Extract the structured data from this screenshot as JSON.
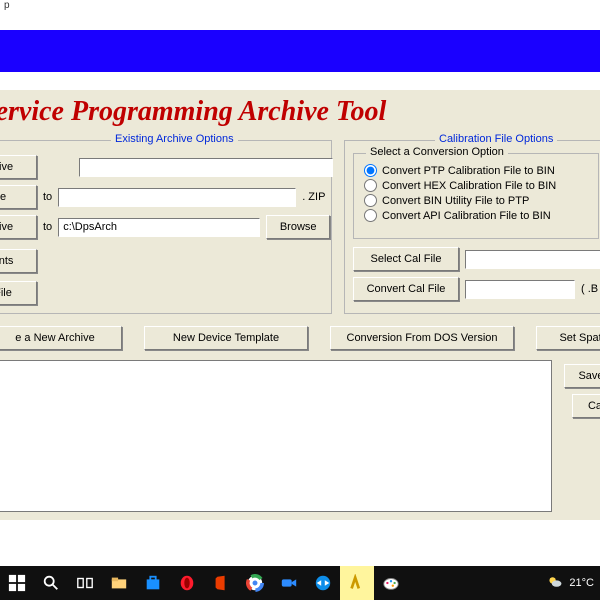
{
  "menu_hint": "p",
  "app_title": "Service Programming Archive Tool",
  "existing": {
    "legend": "Existing Archive Options",
    "btn_hive": "hive",
    "btn_e": "e",
    "to1": "to",
    "zip": ". ZIP",
    "btn_hive2": "hive",
    "to2": "to",
    "default_path": "c:\\DpsArch",
    "browse": "Browse",
    "btn_ents": "ents",
    "btn_file": "File"
  },
  "calib": {
    "legend": "Calibration File Options",
    "sub_legend": "Select a Conversion Option",
    "opts": [
      "Convert PTP Calibration  File to BIN",
      "Convert HEX  Calibration  File to BIN",
      "Convert  BIN Utility  File to  PTP",
      "Convert API Calibration  File to BIN"
    ],
    "select_cal": "Select Cal File",
    "convert_cal": "Convert Cal File",
    "ext": "( .B"
  },
  "lower_buttons": {
    "new_archive": "e a New Archive",
    "new_template": "New Device Template",
    "dos": "Conversion From DOS Version",
    "spat": "Set Spat Defaul"
  },
  "side_buttons": {
    "save": "Save",
    "ca": "Ca"
  },
  "taskbar": {
    "temp": "21°C"
  }
}
